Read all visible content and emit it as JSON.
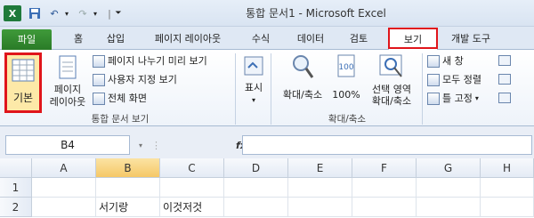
{
  "titlebar": {
    "title": "통합 문서1 - Microsoft Excel"
  },
  "tabs": [
    {
      "label": "파일"
    },
    {
      "label": "홈"
    },
    {
      "label": "삽입"
    },
    {
      "label": "페이지 레이아웃"
    },
    {
      "label": "수식"
    },
    {
      "label": "데이터"
    },
    {
      "label": "검토"
    },
    {
      "label": "보기"
    },
    {
      "label": "개발 도구"
    }
  ],
  "ribbon": {
    "workbook_views": {
      "group_label": "통합 문서 보기",
      "normal": "기본",
      "page_layout": "페이지 레이아웃",
      "page_break_preview": "페이지 나누기 미리 보기",
      "custom_views": "사용자 지정 보기",
      "full_screen": "전체 화면"
    },
    "show": {
      "label": "표시"
    },
    "zoom": {
      "group_label": "확대/축소",
      "zoom": "확대/축소",
      "hundred": "100%",
      "zoom_selection": "선택 영역 확대/축소"
    },
    "window": {
      "new_window": "새 창",
      "arrange_all": "모두 정렬",
      "freeze_panes": "틀 고정"
    }
  },
  "formula_bar": {
    "name_box": "B4",
    "fx": "fx",
    "value": ""
  },
  "grid": {
    "columns": [
      "A",
      "B",
      "C",
      "D",
      "E",
      "F",
      "G",
      "H"
    ],
    "rows": [
      "1",
      "2"
    ],
    "cells": {
      "B2": "서기랑",
      "C2": "이것저것"
    }
  }
}
